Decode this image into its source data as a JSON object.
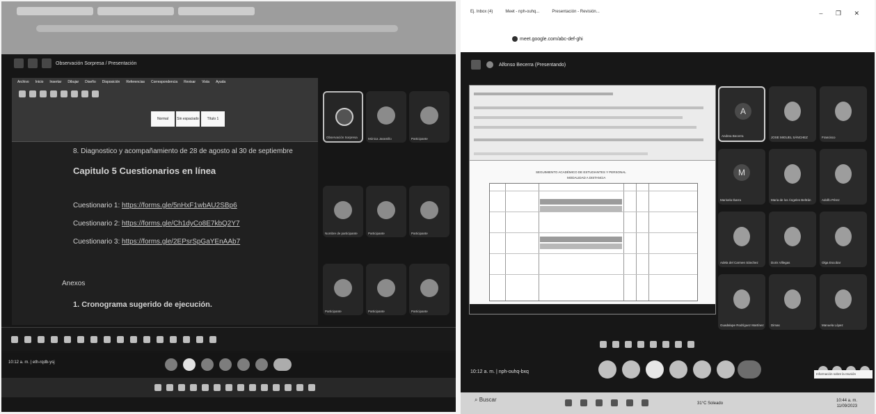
{
  "left_photo": {
    "browser_tabs": [
      "",
      "",
      ""
    ],
    "meet_title": "Observación Sorpresa / Presentación",
    "ribbon_tabs": [
      "Archivo",
      "Inicio",
      "Insertar",
      "Dibujar",
      "Diseño",
      "Disposición",
      "Referencias",
      "Correspondencia",
      "Revisar",
      "Vista",
      "Ayuda"
    ],
    "styles": [
      "Normal",
      "Sin espaciado",
      "Título 1"
    ],
    "doc": {
      "bullet_line": "8. Diagnostico y acompañamiento de 28 de agosto al 30 de septiembre",
      "chapter_heading": "Capitulo 5 Cuestionarios en línea",
      "questionnaires": [
        {
          "label": "Cuestionario 1:",
          "link": "https://forms.gle/5nHxF1wbAU2SBp6"
        },
        {
          "label": "Cuestionario 2:",
          "link": "https://forms.gle/Ch1dyCo8E7kbQ2Y7"
        },
        {
          "label": "Cuestionario 3:",
          "link": "https://forms.gle/2EPsrSpGaYEnAAb7"
        }
      ],
      "annex_heading": "Anexos",
      "annex_item": "1. Cronograma sugerido de ejecución."
    },
    "participants": [
      {
        "name": "Observación Sorpresa"
      },
      {
        "name": "Mónica Jaramillo"
      },
      {
        "name": "Participante"
      },
      {
        "name": "Nombre de participante"
      },
      {
        "name": "Participante"
      },
      {
        "name": "Participante"
      },
      {
        "name": "Participante"
      },
      {
        "name": "Participante"
      },
      {
        "name": "Participante"
      }
    ],
    "meeting_code": "10:12 a. m. | eth-rqdb-ysj"
  },
  "right_photo": {
    "browser_tabs": [
      "Ej. Inbox (4)",
      "Meet - nph-ouhq...",
      "Presentación - Revisión..."
    ],
    "url": "meet.google.com/abc-def-ghi",
    "window_controls": "– ❐ ✕",
    "meet_title": "Alfonso Becerra (Presentando)",
    "spreadsheet_caption": "SEGUIMIENTO ACADÉMICO DE ESTUDIANTES Y PERSONAL",
    "spreadsheet_subcaption": "MODALIDAD A DISTANCIA",
    "participants": [
      {
        "name": "Andrea Becerra",
        "initial": "A",
        "active": true
      },
      {
        "name": "JOSE MIGUEL SÁNCHEZ",
        "initial": ""
      },
      {
        "name": "Francisco",
        "initial": ""
      },
      {
        "name": "Marisela Ibarra",
        "initial": "M"
      },
      {
        "name": "Maria de los Ángeles Beltrán",
        "initial": ""
      },
      {
        "name": "Adolfo Pérez",
        "initial": ""
      },
      {
        "name": "Adela del Carmen Sánchez",
        "initial": ""
      },
      {
        "name": "Doris Villegas",
        "initial": ""
      },
      {
        "name": "Olga Escobar",
        "initial": ""
      },
      {
        "name": "Guadalupe Rodríguez Martínez",
        "initial": ""
      },
      {
        "name": "Dimas",
        "initial": ""
      },
      {
        "name": "Manuela López",
        "initial": ""
      }
    ],
    "meeting_code": "10:12 a. m. | nph-ouhq-bxq",
    "tooltip": "Información sobre la reunión",
    "taskbar_search": "Buscar",
    "weather": "31°C Soleado",
    "clock_time": "10:44 a. m.",
    "clock_date": "11/09/2023"
  }
}
